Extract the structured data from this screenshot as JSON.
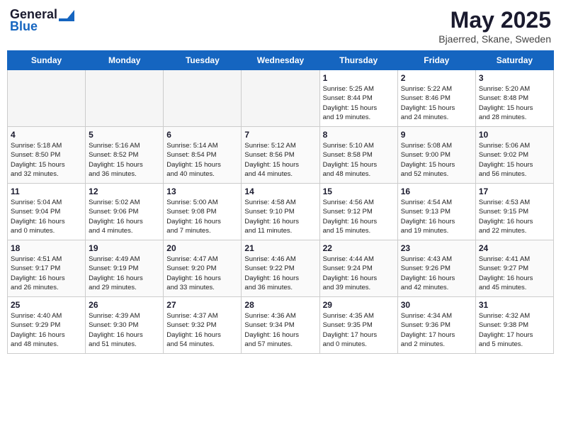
{
  "header": {
    "logo_line1": "General",
    "logo_line2": "Blue",
    "month": "May 2025",
    "location": "Bjaerred, Skane, Sweden"
  },
  "days_of_week": [
    "Sunday",
    "Monday",
    "Tuesday",
    "Wednesday",
    "Thursday",
    "Friday",
    "Saturday"
  ],
  "weeks": [
    [
      {
        "day": "",
        "empty": true
      },
      {
        "day": "",
        "empty": true
      },
      {
        "day": "",
        "empty": true
      },
      {
        "day": "",
        "empty": true
      },
      {
        "day": "1",
        "lines": [
          "Sunrise: 5:25 AM",
          "Sunset: 8:44 PM",
          "Daylight: 15 hours",
          "and 19 minutes."
        ]
      },
      {
        "day": "2",
        "lines": [
          "Sunrise: 5:22 AM",
          "Sunset: 8:46 PM",
          "Daylight: 15 hours",
          "and 24 minutes."
        ]
      },
      {
        "day": "3",
        "lines": [
          "Sunrise: 5:20 AM",
          "Sunset: 8:48 PM",
          "Daylight: 15 hours",
          "and 28 minutes."
        ]
      }
    ],
    [
      {
        "day": "4",
        "lines": [
          "Sunrise: 5:18 AM",
          "Sunset: 8:50 PM",
          "Daylight: 15 hours",
          "and 32 minutes."
        ]
      },
      {
        "day": "5",
        "lines": [
          "Sunrise: 5:16 AM",
          "Sunset: 8:52 PM",
          "Daylight: 15 hours",
          "and 36 minutes."
        ]
      },
      {
        "day": "6",
        "lines": [
          "Sunrise: 5:14 AM",
          "Sunset: 8:54 PM",
          "Daylight: 15 hours",
          "and 40 minutes."
        ]
      },
      {
        "day": "7",
        "lines": [
          "Sunrise: 5:12 AM",
          "Sunset: 8:56 PM",
          "Daylight: 15 hours",
          "and 44 minutes."
        ]
      },
      {
        "day": "8",
        "lines": [
          "Sunrise: 5:10 AM",
          "Sunset: 8:58 PM",
          "Daylight: 15 hours",
          "and 48 minutes."
        ]
      },
      {
        "day": "9",
        "lines": [
          "Sunrise: 5:08 AM",
          "Sunset: 9:00 PM",
          "Daylight: 15 hours",
          "and 52 minutes."
        ]
      },
      {
        "day": "10",
        "lines": [
          "Sunrise: 5:06 AM",
          "Sunset: 9:02 PM",
          "Daylight: 15 hours",
          "and 56 minutes."
        ]
      }
    ],
    [
      {
        "day": "11",
        "lines": [
          "Sunrise: 5:04 AM",
          "Sunset: 9:04 PM",
          "Daylight: 16 hours",
          "and 0 minutes."
        ]
      },
      {
        "day": "12",
        "lines": [
          "Sunrise: 5:02 AM",
          "Sunset: 9:06 PM",
          "Daylight: 16 hours",
          "and 4 minutes."
        ]
      },
      {
        "day": "13",
        "lines": [
          "Sunrise: 5:00 AM",
          "Sunset: 9:08 PM",
          "Daylight: 16 hours",
          "and 7 minutes."
        ]
      },
      {
        "day": "14",
        "lines": [
          "Sunrise: 4:58 AM",
          "Sunset: 9:10 PM",
          "Daylight: 16 hours",
          "and 11 minutes."
        ]
      },
      {
        "day": "15",
        "lines": [
          "Sunrise: 4:56 AM",
          "Sunset: 9:12 PM",
          "Daylight: 16 hours",
          "and 15 minutes."
        ]
      },
      {
        "day": "16",
        "lines": [
          "Sunrise: 4:54 AM",
          "Sunset: 9:13 PM",
          "Daylight: 16 hours",
          "and 19 minutes."
        ]
      },
      {
        "day": "17",
        "lines": [
          "Sunrise: 4:53 AM",
          "Sunset: 9:15 PM",
          "Daylight: 16 hours",
          "and 22 minutes."
        ]
      }
    ],
    [
      {
        "day": "18",
        "lines": [
          "Sunrise: 4:51 AM",
          "Sunset: 9:17 PM",
          "Daylight: 16 hours",
          "and 26 minutes."
        ]
      },
      {
        "day": "19",
        "lines": [
          "Sunrise: 4:49 AM",
          "Sunset: 9:19 PM",
          "Daylight: 16 hours",
          "and 29 minutes."
        ]
      },
      {
        "day": "20",
        "lines": [
          "Sunrise: 4:47 AM",
          "Sunset: 9:20 PM",
          "Daylight: 16 hours",
          "and 33 minutes."
        ]
      },
      {
        "day": "21",
        "lines": [
          "Sunrise: 4:46 AM",
          "Sunset: 9:22 PM",
          "Daylight: 16 hours",
          "and 36 minutes."
        ]
      },
      {
        "day": "22",
        "lines": [
          "Sunrise: 4:44 AM",
          "Sunset: 9:24 PM",
          "Daylight: 16 hours",
          "and 39 minutes."
        ]
      },
      {
        "day": "23",
        "lines": [
          "Sunrise: 4:43 AM",
          "Sunset: 9:26 PM",
          "Daylight: 16 hours",
          "and 42 minutes."
        ]
      },
      {
        "day": "24",
        "lines": [
          "Sunrise: 4:41 AM",
          "Sunset: 9:27 PM",
          "Daylight: 16 hours",
          "and 45 minutes."
        ]
      }
    ],
    [
      {
        "day": "25",
        "lines": [
          "Sunrise: 4:40 AM",
          "Sunset: 9:29 PM",
          "Daylight: 16 hours",
          "and 48 minutes."
        ]
      },
      {
        "day": "26",
        "lines": [
          "Sunrise: 4:39 AM",
          "Sunset: 9:30 PM",
          "Daylight: 16 hours",
          "and 51 minutes."
        ]
      },
      {
        "day": "27",
        "lines": [
          "Sunrise: 4:37 AM",
          "Sunset: 9:32 PM",
          "Daylight: 16 hours",
          "and 54 minutes."
        ]
      },
      {
        "day": "28",
        "lines": [
          "Sunrise: 4:36 AM",
          "Sunset: 9:34 PM",
          "Daylight: 16 hours",
          "and 57 minutes."
        ]
      },
      {
        "day": "29",
        "lines": [
          "Sunrise: 4:35 AM",
          "Sunset: 9:35 PM",
          "Daylight: 17 hours",
          "and 0 minutes."
        ]
      },
      {
        "day": "30",
        "lines": [
          "Sunrise: 4:34 AM",
          "Sunset: 9:36 PM",
          "Daylight: 17 hours",
          "and 2 minutes."
        ]
      },
      {
        "day": "31",
        "lines": [
          "Sunrise: 4:32 AM",
          "Sunset: 9:38 PM",
          "Daylight: 17 hours",
          "and 5 minutes."
        ]
      }
    ]
  ]
}
